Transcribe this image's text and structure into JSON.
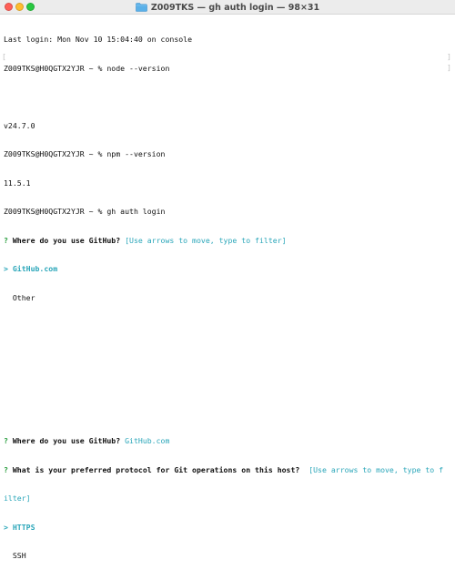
{
  "window": {
    "title": "Z009TKS — gh auth login — 98×31"
  },
  "terminal": {
    "last_login": "Last login: Mon Nov 10 15:04:40 on console",
    "prompt1": "Z009TKS@H0QGTX2YJR ~ % ",
    "cmd1": "node --version",
    "out1": "v24.7.0",
    "prompt2": "Z009TKS@H0QGTX2YJR ~ % ",
    "cmd2": "npm --version",
    "out2": "11.5.1",
    "prompt3": "Z009TKS@H0QGTX2YJR ~ % ",
    "cmd3": "gh auth login",
    "q1_mark": "?",
    "q1_text": " Where do you use GitHub?",
    "q1_hint": " [Use arrows to move, type to filter]",
    "q1_cursor": "> ",
    "q1_option1": "GitHub.com",
    "q1_option2": "  Other",
    "a1_mark": "?",
    "a1_text": " Where do you use GitHub?",
    "a1_answer": " GitHub.com",
    "q2_mark": "?",
    "q2_text": " What is your preferred protocol for Git operations on this host?",
    "q2_hint": "  [Use arrows to move, type to f",
    "q2_hint_wrap": "ilter]",
    "q2_cursor": "> ",
    "q2_option1": "HTTPS",
    "q2_option2": "  SSH"
  },
  "colors": {
    "prompt_green": "#2ea043",
    "accent_cyan": "#2aa6b9"
  }
}
